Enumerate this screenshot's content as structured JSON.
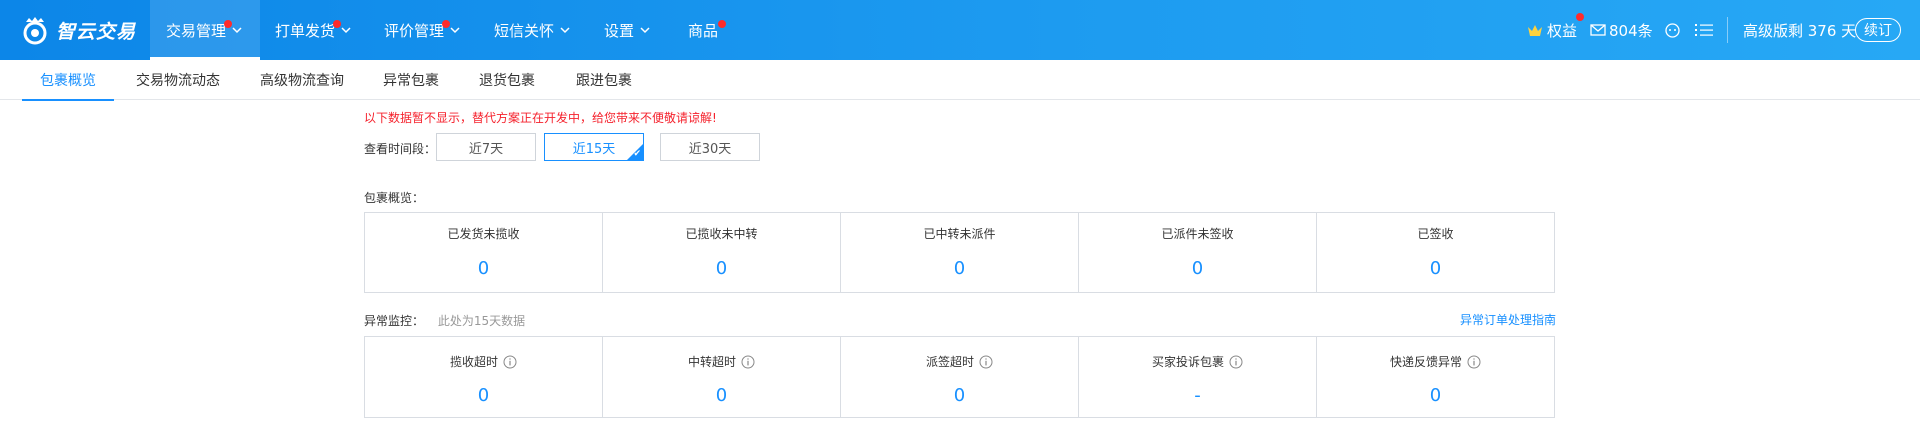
{
  "app": {
    "logo_text": "智云交易",
    "nav": [
      {
        "label": "交易管理",
        "dot": true,
        "chevron": true
      },
      {
        "label": "打单发货",
        "dot": true,
        "chevron": true
      },
      {
        "label": "评价管理",
        "dot": true,
        "chevron": true
      },
      {
        "label": "短信关怀",
        "dot": false,
        "chevron": true
      },
      {
        "label": "设置",
        "dot": false,
        "chevron": true
      },
      {
        "label": "商品",
        "dot": true,
        "chevron": false
      }
    ],
    "rights_label": "权益",
    "message_count": "804条",
    "plan_text": "高级版剩 376 天",
    "renew_label": "续订"
  },
  "subtabs": [
    "包裹概览",
    "交易物流动态",
    "高级物流查询",
    "异常包裹",
    "退货包裹",
    "跟进包裹"
  ],
  "notice": "以下数据暂不显示，替代方案正在开发中，给您带来不便敬请谅解!",
  "period": {
    "label": "查看时间段：",
    "options": [
      "近7天",
      "近15天",
      "近30天"
    ],
    "selected": "近15天"
  },
  "overview": {
    "title": "包裹概览：",
    "cards": [
      {
        "title": "已发货未揽收",
        "value": "0"
      },
      {
        "title": "已揽收未中转",
        "value": "0"
      },
      {
        "title": "已中转未派件",
        "value": "0"
      },
      {
        "title": "已派件未签收",
        "value": "0"
      },
      {
        "title": "已签收",
        "value": "0"
      }
    ]
  },
  "monitor": {
    "title": "异常监控：",
    "note": "此处为15天数据",
    "guide_link": "异常订单处理指南",
    "cards": [
      {
        "title": "揽收超时",
        "value": "0"
      },
      {
        "title": "中转超时",
        "value": "0"
      },
      {
        "title": "派签超时",
        "value": "0"
      },
      {
        "title": "买家投诉包裹",
        "value": "-"
      },
      {
        "title": "快递反馈异常",
        "value": "0"
      }
    ]
  },
  "colors": {
    "primary": "#1890ff",
    "warning": "#f5222d",
    "header_start": "#0c86e8",
    "header_end": "#27a8f5"
  }
}
